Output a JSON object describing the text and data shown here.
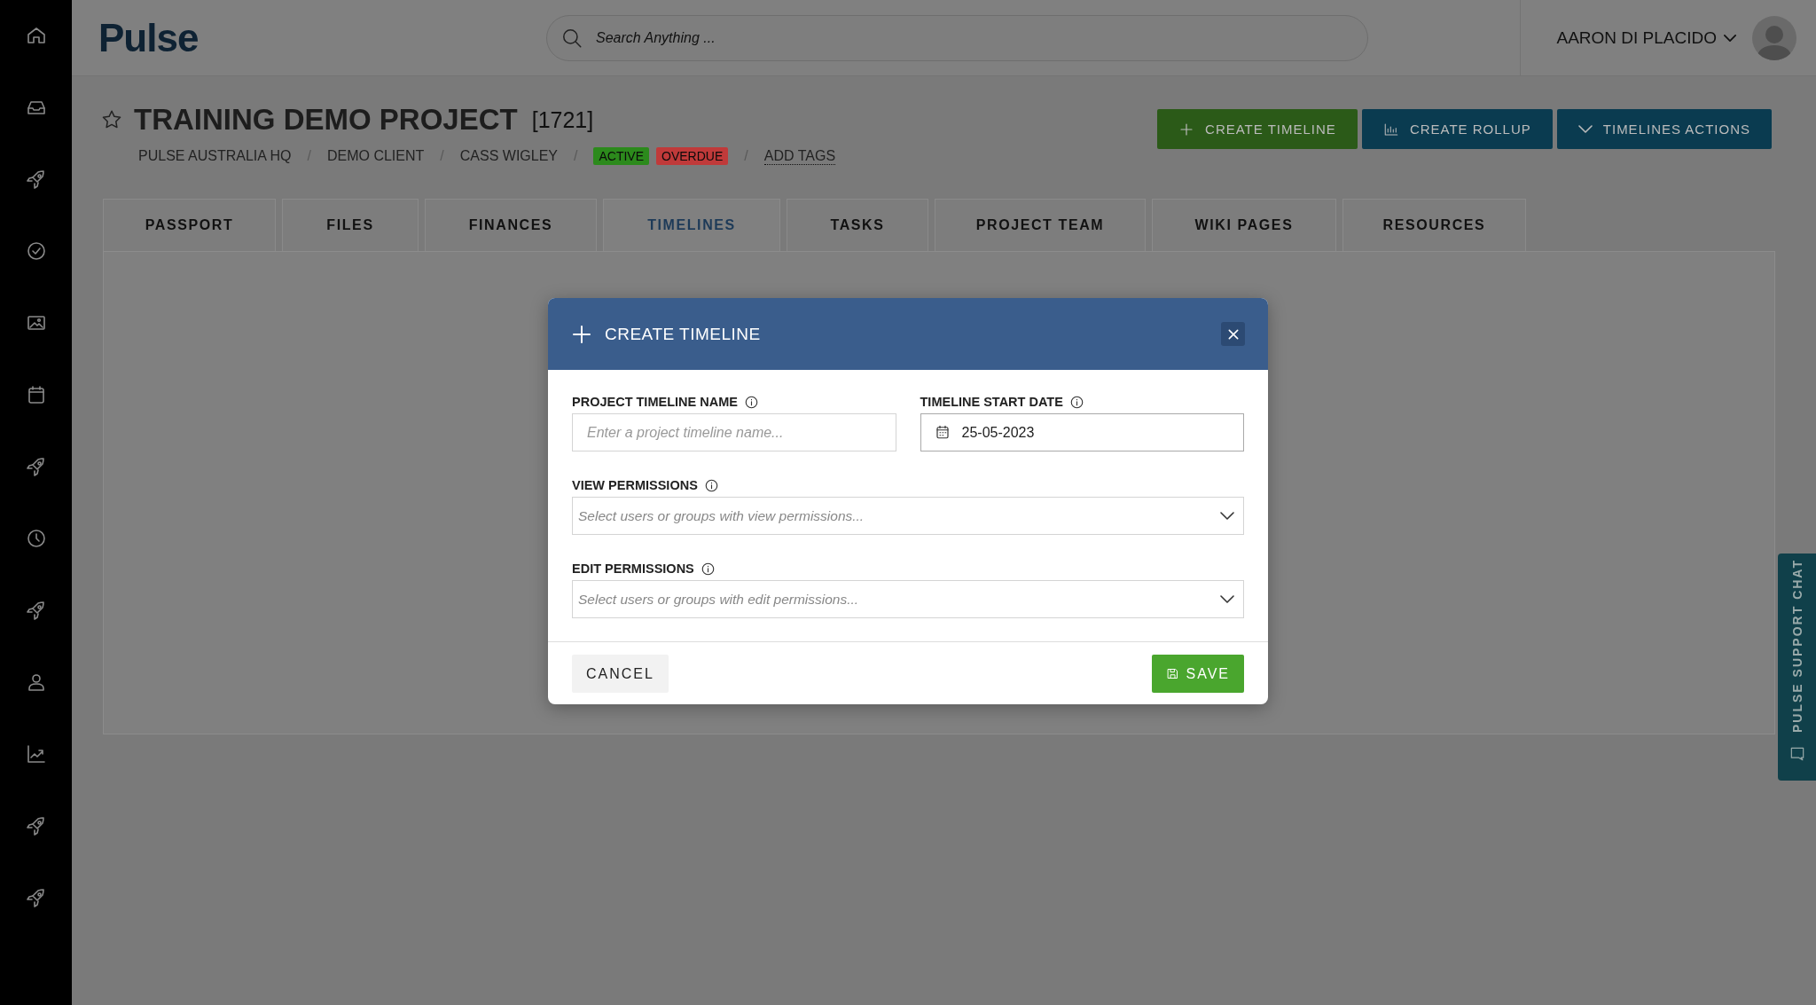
{
  "header": {
    "logo": "Pulse",
    "search": {
      "placeholder": "Search Anything ..."
    },
    "user": "AARON DI PLACIDO"
  },
  "project": {
    "title": "TRAINING DEMO PROJECT",
    "number": "[1721]",
    "breadcrumbs": [
      "PULSE AUSTRALIA HQ",
      "DEMO CLIENT",
      "CASS WIGLEY"
    ],
    "separators": [
      "/",
      "/",
      "/",
      "/"
    ],
    "tags": [
      {
        "label": "ACTIVE",
        "color": "#2c8a1c"
      },
      {
        "label": "OVERDUE",
        "color": "#c03a3a"
      }
    ],
    "add_tags": "ADD TAGS"
  },
  "actions": [
    {
      "label": "CREATE TIMELINE",
      "kind": "plus",
      "color": "#2b5a18"
    },
    {
      "label": "CREATE ROLLUP",
      "kind": "chart",
      "color": "#0a3b50"
    },
    {
      "label": "TIMELINES ACTIONS",
      "kind": "caret",
      "color": "#0a3b50"
    }
  ],
  "tabs": [
    {
      "label": "PASSPORT",
      "selected": false
    },
    {
      "label": "FILES",
      "selected": false
    },
    {
      "label": "FINANCES",
      "selected": false
    },
    {
      "label": "TIMELINES",
      "selected": true
    },
    {
      "label": "TASKS",
      "selected": false
    },
    {
      "label": "PROJECT TEAM",
      "selected": false
    },
    {
      "label": "WIKI PAGES",
      "selected": false
    },
    {
      "label": "RESOURCES",
      "selected": false
    }
  ],
  "modal": {
    "title": "CREATE TIMELINE",
    "fields": [
      {
        "kind": "text",
        "label": "PROJECT TIMELINE NAME",
        "placeholder": "Enter a project timeline name..."
      },
      {
        "kind": "date",
        "label": "TIMELINE START DATE",
        "value": "25-05-2023"
      },
      {
        "kind": "select",
        "label": "VIEW PERMISSIONS",
        "placeholder": "Select users or groups with view permissions..."
      },
      {
        "kind": "select",
        "label": "EDIT PERMISSIONS",
        "placeholder": "Select users or groups with edit permissions..."
      }
    ],
    "cancel": "CANCEL",
    "save": "SAVE"
  },
  "chat": {
    "label": "PULSE SUPPORT CHAT"
  }
}
